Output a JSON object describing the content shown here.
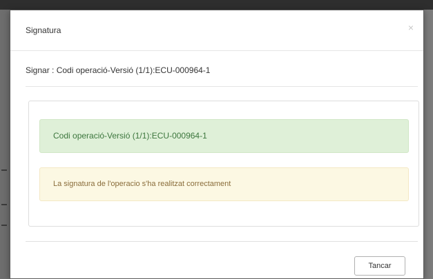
{
  "modal": {
    "title": "Signatura",
    "close_icon": "×",
    "sign_line": "Signar : Codi operació-Versió (1/1):ECU-000964-1",
    "success_message": "Codi operació-Versió (1/1):ECU-000964-1",
    "warning_message": "La signatura de l'operacio s'ha realitzat correctament",
    "close_button_label": "Tancar"
  },
  "colors": {
    "success_bg": "#dff0d8",
    "success_text": "#3c763d",
    "warning_bg": "#fcf8e3",
    "warning_text": "#8a6d3b"
  }
}
